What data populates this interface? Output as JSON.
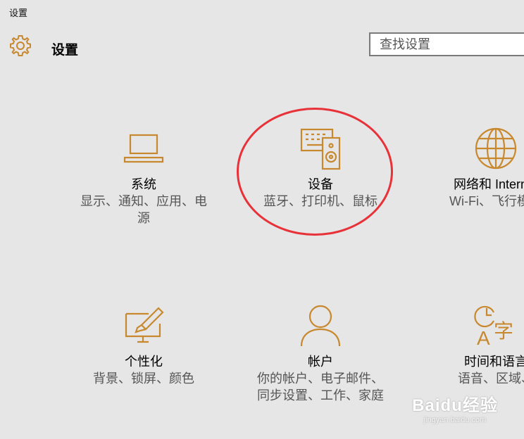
{
  "window": {
    "title": "设置"
  },
  "header": {
    "title": "设置",
    "icon": "gear-icon"
  },
  "search": {
    "placeholder": "查找设置"
  },
  "accent_color": "#c8882e",
  "tiles": [
    {
      "name": "系统",
      "desc_lines": [
        "显示、通知、应用、电",
        "源"
      ],
      "icon": "laptop-icon"
    },
    {
      "name": "设备",
      "desc_lines": [
        "蓝牙、打印机、鼠标"
      ],
      "icon": "devices-icon"
    },
    {
      "name": "网络和 Internet",
      "desc_lines": [
        "Wi-Fi、飞行模式"
      ],
      "icon": "globe-icon"
    },
    {
      "name": "个性化",
      "desc_lines": [
        "背景、锁屏、颜色"
      ],
      "icon": "paint-icon"
    },
    {
      "name": "帐户",
      "desc_lines": [
        "你的帐户、电子邮件、",
        "同步设置、工作、家庭"
      ],
      "icon": "person-icon"
    },
    {
      "name": "时间和语言",
      "desc_lines": [
        "语音、区域、"
      ],
      "icon": "time-language-icon"
    }
  ],
  "annotation": {
    "color": "#e8323a"
  },
  "watermark": {
    "main": "Baidu经验",
    "sub": "jingyan.baidu.com"
  }
}
